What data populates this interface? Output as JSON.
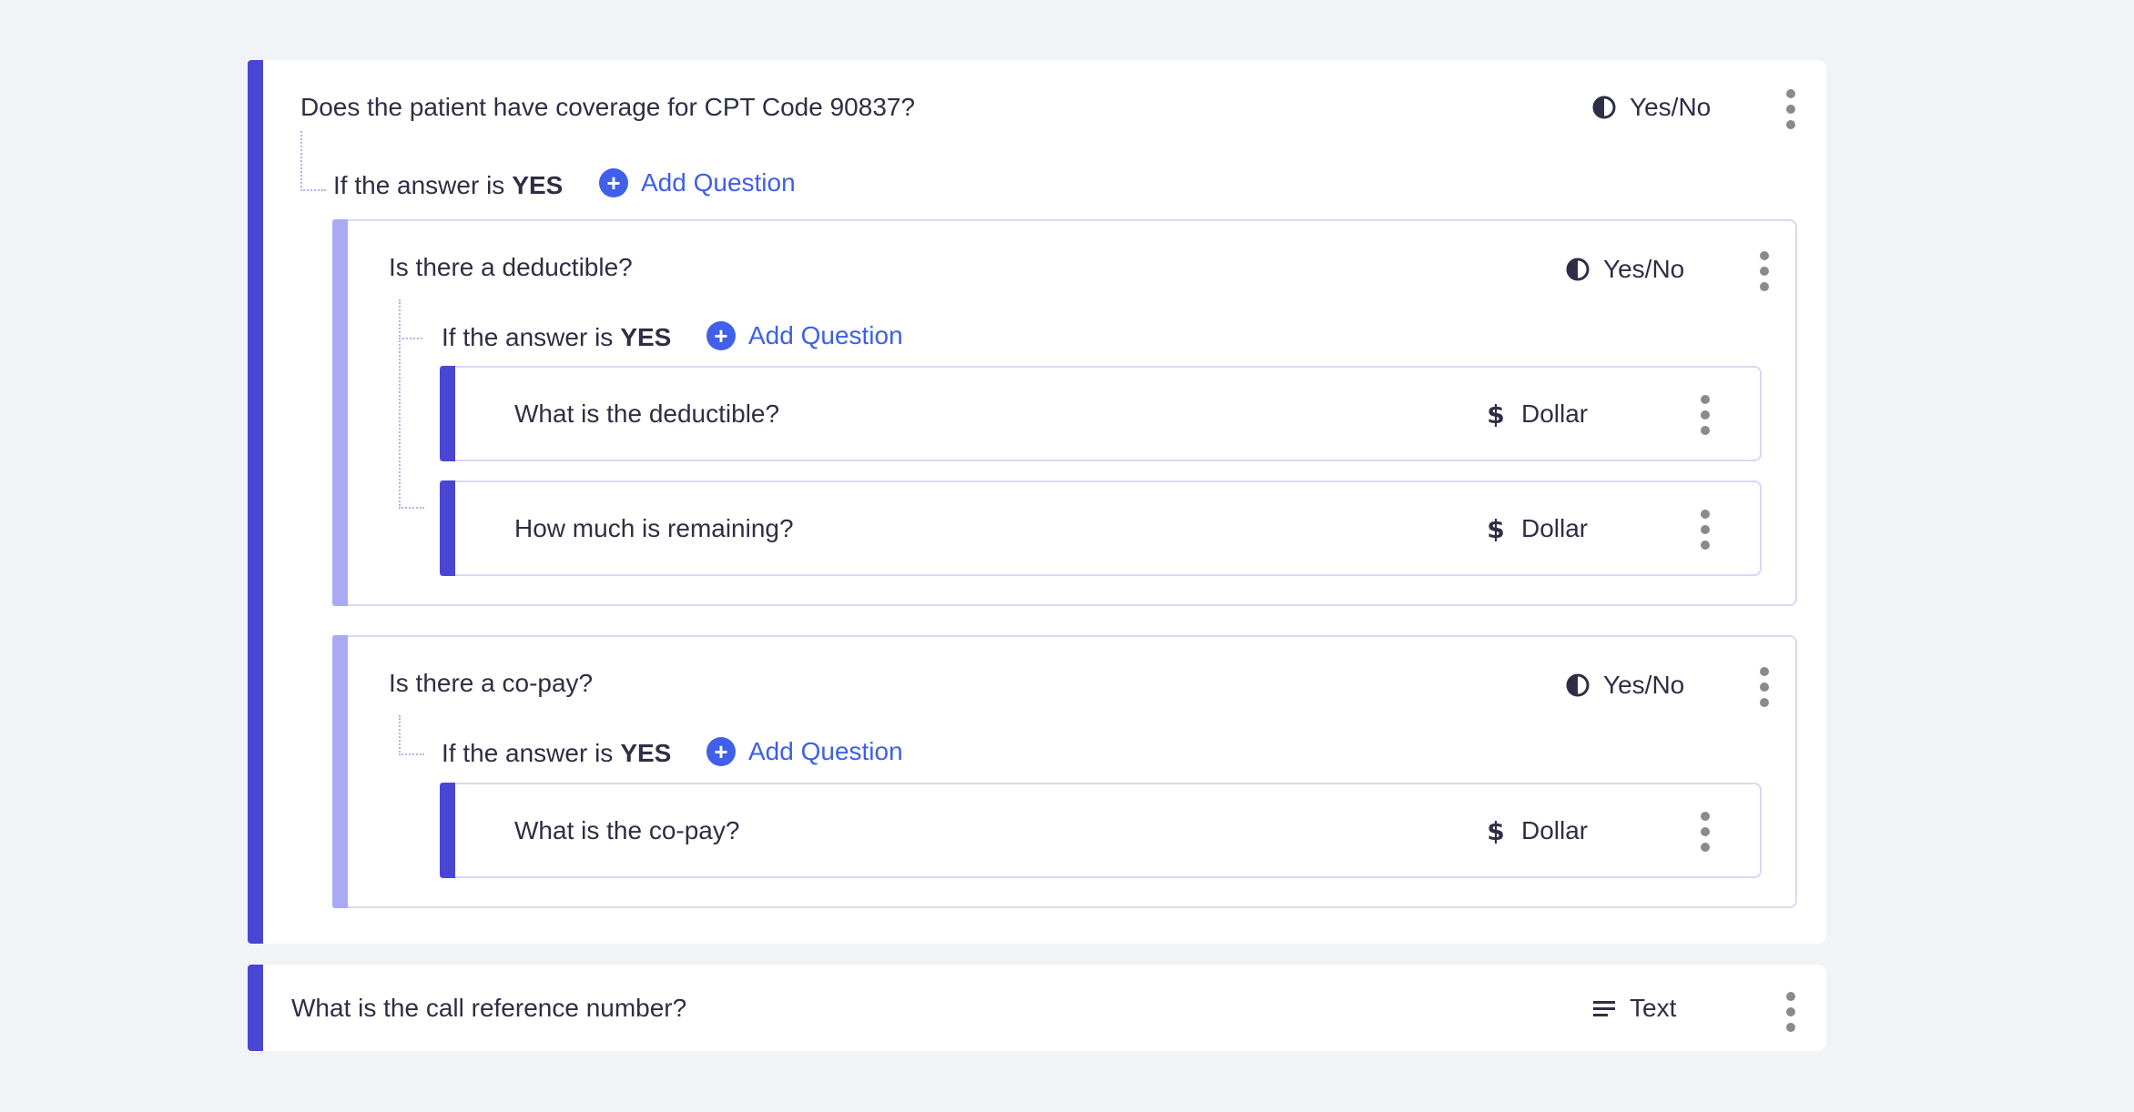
{
  "icons": {
    "yesno": "half-circle-icon",
    "dollar": "dollar-icon",
    "text": "text-lines-icon",
    "menu": "kebab-menu-icon",
    "add": "plus-circle-icon"
  },
  "colors": {
    "primary_bar": "#4a46d4",
    "sub_bar": "#a9aaf1",
    "link": "#3e5fe9",
    "background": "#f2f3f7"
  },
  "questions": {
    "coverage": {
      "text": "Does the patient have coverage for CPT Code 90837?",
      "type_label": "Yes/No",
      "condition_prefix": "If the answer is",
      "condition_value": "YES",
      "add_label": "Add Question"
    },
    "deductible": {
      "text": "Is there a deductible?",
      "type_label": "Yes/No",
      "condition_prefix": "If the answer is",
      "condition_value": "YES",
      "add_label": "Add Question",
      "children": [
        {
          "text": "What is the deductible?",
          "type_label": "Dollar"
        },
        {
          "text": "How much is remaining?",
          "type_label": "Dollar"
        }
      ]
    },
    "copay": {
      "text": "Is there a co-pay?",
      "type_label": "Yes/No",
      "condition_prefix": "If the answer is",
      "condition_value": "YES",
      "add_label": "Add Question",
      "children": [
        {
          "text": "What is the co-pay?",
          "type_label": "Dollar"
        }
      ]
    },
    "reference": {
      "text": "What is the call reference number?",
      "type_label": "Text"
    }
  }
}
